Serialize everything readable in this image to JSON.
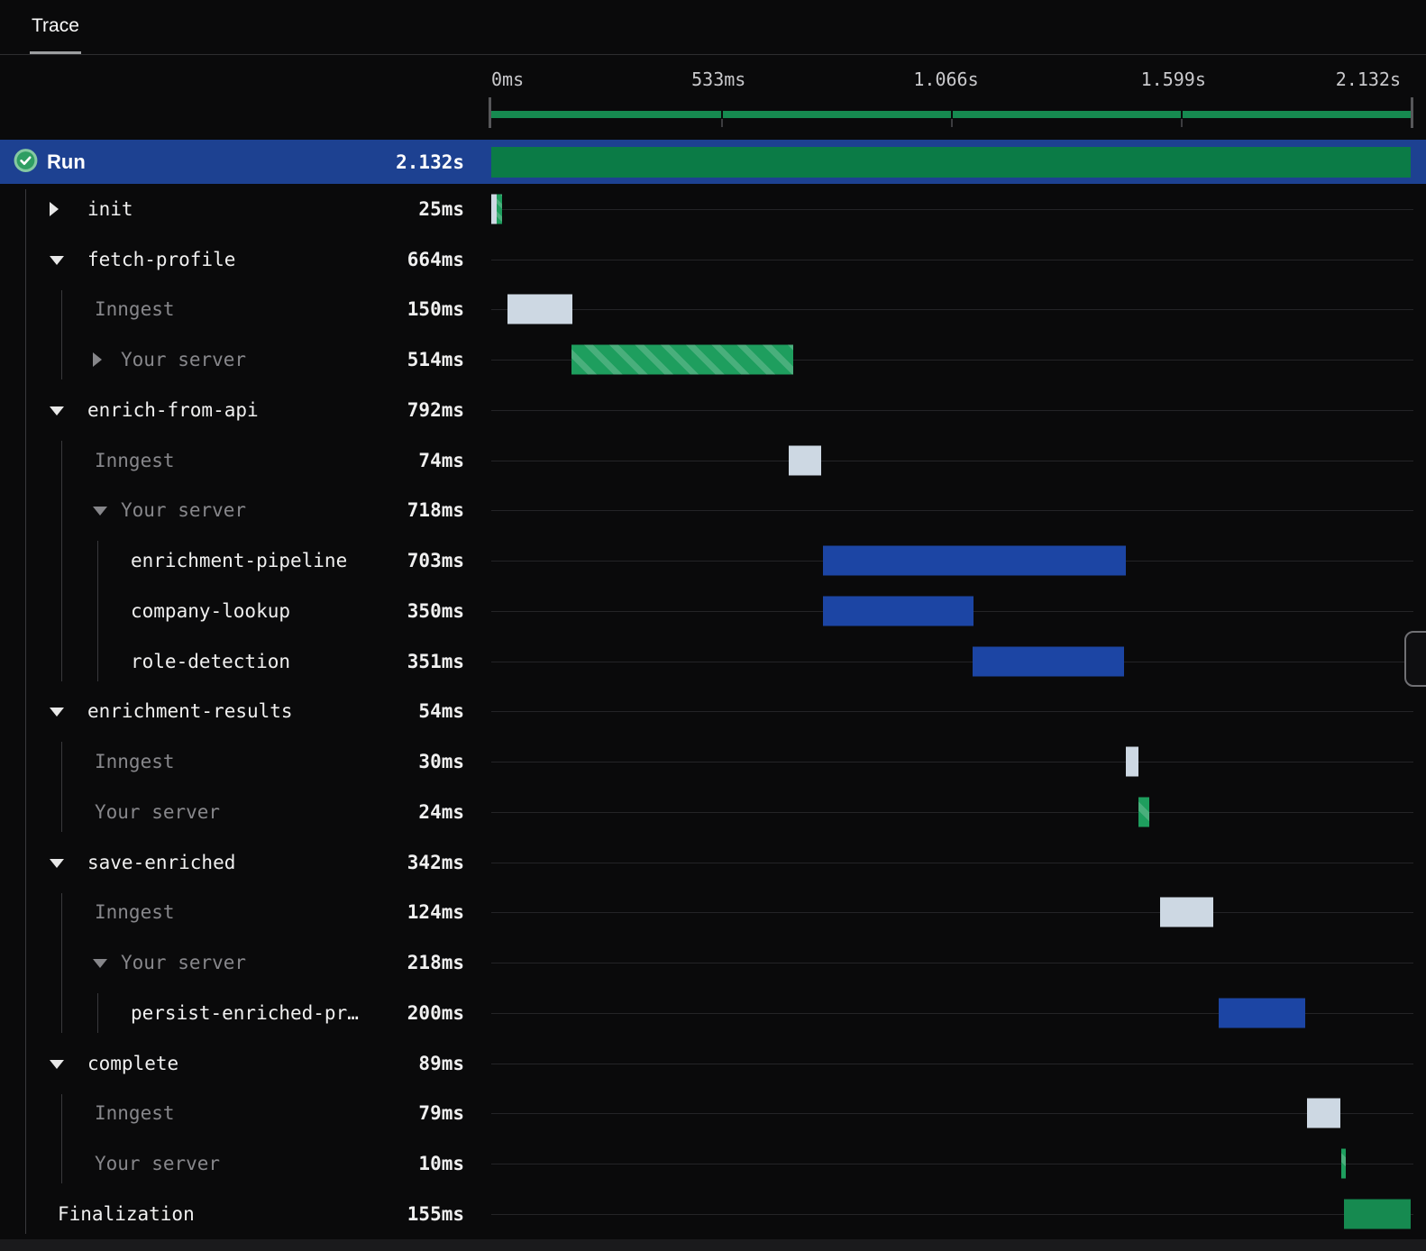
{
  "tab": {
    "label": "Trace"
  },
  "timeline": {
    "total_ms": 2132,
    "axis_ticks": [
      "0ms",
      "533ms",
      "1.066s",
      "1.599s",
      "2.132s"
    ]
  },
  "run": {
    "label": "Run",
    "duration": "2.132s",
    "status": "completed"
  },
  "rows": [
    {
      "name": "init",
      "duration": "25ms",
      "level": 1,
      "chevron": "right",
      "muted": false,
      "bar": {
        "type": "split",
        "start": 0,
        "dur": 25
      }
    },
    {
      "name": "fetch-profile",
      "duration": "664ms",
      "level": 1,
      "chevron": "down",
      "muted": false,
      "bar": null
    },
    {
      "name": "Inngest",
      "duration": "150ms",
      "level": 2,
      "chevron": null,
      "muted": true,
      "bar": {
        "type": "light",
        "start": 38,
        "dur": 150
      }
    },
    {
      "name": "Your server",
      "duration": "514ms",
      "level": 2,
      "chevron": "right",
      "muted": true,
      "bar": {
        "type": "hatched",
        "start": 186,
        "dur": 514
      }
    },
    {
      "name": "enrich-from-api",
      "duration": "792ms",
      "level": 1,
      "chevron": "down",
      "muted": false,
      "bar": null
    },
    {
      "name": "Inngest",
      "duration": "74ms",
      "level": 2,
      "chevron": null,
      "muted": true,
      "bar": {
        "type": "light",
        "start": 690,
        "dur": 74
      }
    },
    {
      "name": "Your server",
      "duration": "718ms",
      "level": 2,
      "chevron": "down",
      "muted": true,
      "bar": null
    },
    {
      "name": "enrichment-pipeline",
      "duration": "703ms",
      "level": 3,
      "chevron": null,
      "muted": false,
      "bar": {
        "type": "blue",
        "start": 769,
        "dur": 703
      }
    },
    {
      "name": "company-lookup",
      "duration": "350ms",
      "level": 3,
      "chevron": null,
      "muted": false,
      "bar": {
        "type": "blue",
        "start": 769,
        "dur": 350
      }
    },
    {
      "name": "role-detection",
      "duration": "351ms",
      "level": 3,
      "chevron": null,
      "muted": false,
      "bar": {
        "type": "blue",
        "start": 1116,
        "dur": 351
      }
    },
    {
      "name": "enrichment-results",
      "duration": "54ms",
      "level": 1,
      "chevron": "down",
      "muted": false,
      "bar": null
    },
    {
      "name": "Inngest",
      "duration": "30ms",
      "level": 2,
      "chevron": null,
      "muted": true,
      "bar": {
        "type": "light",
        "start": 1471,
        "dur": 30
      }
    },
    {
      "name": "Your server",
      "duration": "24ms",
      "level": 2,
      "chevron": null,
      "muted": true,
      "bar": {
        "type": "hatched",
        "start": 1501,
        "dur": 24
      }
    },
    {
      "name": "save-enriched",
      "duration": "342ms",
      "level": 1,
      "chevron": "down",
      "muted": false,
      "bar": null
    },
    {
      "name": "Inngest",
      "duration": "124ms",
      "level": 2,
      "chevron": null,
      "muted": true,
      "bar": {
        "type": "light",
        "start": 1551,
        "dur": 124
      }
    },
    {
      "name": "Your server",
      "duration": "218ms",
      "level": 2,
      "chevron": "down",
      "muted": true,
      "bar": null
    },
    {
      "name": "persist-enriched-pr…",
      "duration": "200ms",
      "level": 3,
      "chevron": null,
      "muted": false,
      "bar": {
        "type": "blue",
        "start": 1687,
        "dur": 200
      }
    },
    {
      "name": "complete",
      "duration": "89ms",
      "level": 1,
      "chevron": "down",
      "muted": false,
      "bar": null
    },
    {
      "name": "Inngest",
      "duration": "79ms",
      "level": 2,
      "chevron": null,
      "muted": true,
      "bar": {
        "type": "light",
        "start": 1891,
        "dur": 79
      }
    },
    {
      "name": "Your server",
      "duration": "10ms",
      "level": 2,
      "chevron": null,
      "muted": true,
      "bar": {
        "type": "hatched",
        "start": 1971,
        "dur": 10
      }
    },
    {
      "name": "Finalization",
      "duration": "155ms",
      "level": 0,
      "chevron": null,
      "muted": false,
      "bar": {
        "type": "green",
        "start": 1977,
        "dur": 155
      }
    }
  ],
  "colors": {
    "background": "#0a0a0b",
    "selected_row_blue": "#1d4191",
    "run_bar_green": "#0b7b46",
    "solid_green": "#168a50",
    "hatch_green_base": "#1e9e5e",
    "hatch_green_stripe": "#49af7c",
    "bar_light": "#cdd8e3",
    "bar_blue": "#1c45a4",
    "muted_text": "#87878b",
    "white_text": "#f0f0f0"
  }
}
